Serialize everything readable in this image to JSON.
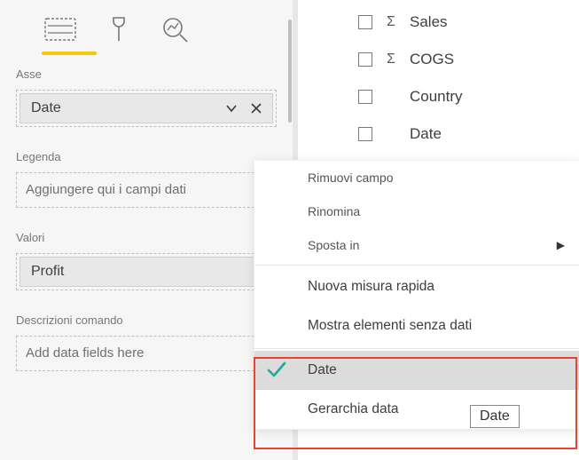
{
  "tabs": {
    "fields": "fields",
    "format": "format",
    "analytics": "analytics"
  },
  "wells": {
    "axis": {
      "label": "Asse",
      "value": "Date"
    },
    "legend": {
      "label": "Legenda",
      "placeholder": "Aggiungere qui i campi dati"
    },
    "values": {
      "label": "Valori",
      "value": "Profit"
    },
    "tooltips": {
      "label": "Descrizioni comando",
      "placeholder": "Add data fields here"
    }
  },
  "fields_list": [
    {
      "name": "Sales",
      "sigma": true
    },
    {
      "name": "COGS",
      "sigma": true
    },
    {
      "name": "Country",
      "sigma": false
    },
    {
      "name": "Date",
      "sigma": false
    }
  ],
  "context_menu": {
    "remove": "Rimuovi campo",
    "rename": "Rinomina",
    "move_to": "Sposta in",
    "new_measure": "Nuova misura rapida",
    "show_no_data": "Mostra elementi senza dati",
    "opt_date": "Date",
    "opt_hierarchy": "Gerarchia data"
  },
  "tooltip": "Date"
}
